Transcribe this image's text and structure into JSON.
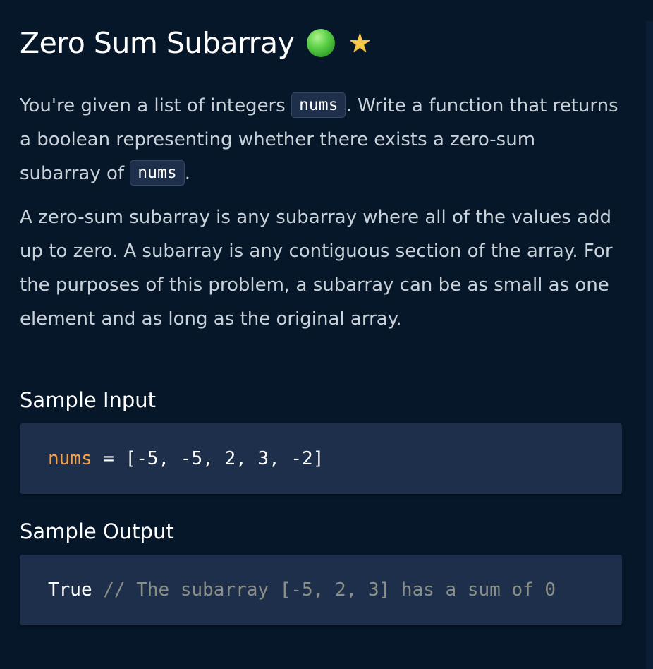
{
  "problem": {
    "title": "Zero Sum Subarray",
    "status_color": "#5fd34a",
    "status_icon": "green-circle-icon",
    "favorite_icon": "star-icon",
    "favorite_glyph": "★"
  },
  "description": {
    "p1_part1": "You're given a list of integers ",
    "p1_code1": "nums",
    "p1_part2": ". Write a function that returns a boolean representing whether there exists a zero-sum subarray of ",
    "p1_code2": "nums",
    "p1_part3": ".",
    "p2": "A zero-sum subarray is any subarray where all of the values add up to zero. A subarray is any contiguous section of the array. For the purposes of this problem, a subarray can be as small as one element and as long as the original array."
  },
  "sample_input": {
    "heading": "Sample Input",
    "var": "nums",
    "op": " = ",
    "value": "[-5, -5, 2, 3, -2]"
  },
  "sample_output": {
    "heading": "Sample Output",
    "value": "True",
    "comment": " // The subarray [-5, 2, 3] has a sum of 0"
  },
  "colors": {
    "background": "#06172a",
    "code_background": "#1d2f4a",
    "variable": "#f5a04a",
    "comment": "#8c8f86"
  }
}
